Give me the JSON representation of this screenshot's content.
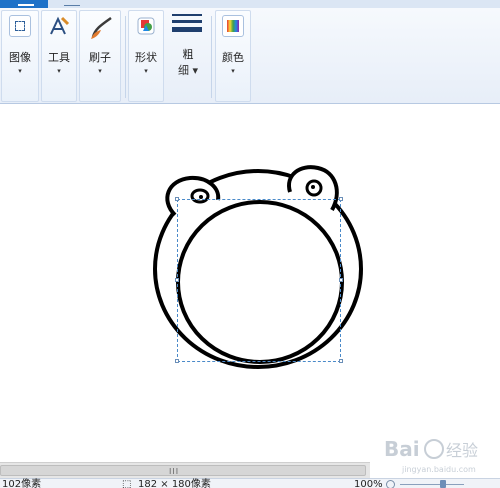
{
  "ribbon": {
    "groups": [
      {
        "label": "图像",
        "arrow": "▾",
        "icon": "select-rect-icon"
      },
      {
        "label": "工具",
        "arrow": "▾",
        "icon": "text-tools-icon"
      },
      {
        "label": "刷子",
        "arrow": "▾",
        "icon": "brush-icon"
      },
      {
        "label": "形状",
        "arrow": "▾",
        "icon": "shapes-icon"
      },
      {
        "label": "粗",
        "label2": "细 ▾",
        "icon": "line-width-icon"
      },
      {
        "label": "颜色",
        "arrow": "▾",
        "icon": "palette-icon"
      }
    ]
  },
  "scrollbar": {
    "grip": "III"
  },
  "status": {
    "cursor_pos": "102像素",
    "selection_size": "182 × 180像素",
    "zoom": "100%"
  },
  "watermark": {
    "text": "Bai 经验",
    "url": "jingyan.baidu.com"
  },
  "colors": {
    "ribbon_top": "#f6f9fd",
    "tab_active": "#1e72c8",
    "selection_border": "#4a8ac9"
  }
}
